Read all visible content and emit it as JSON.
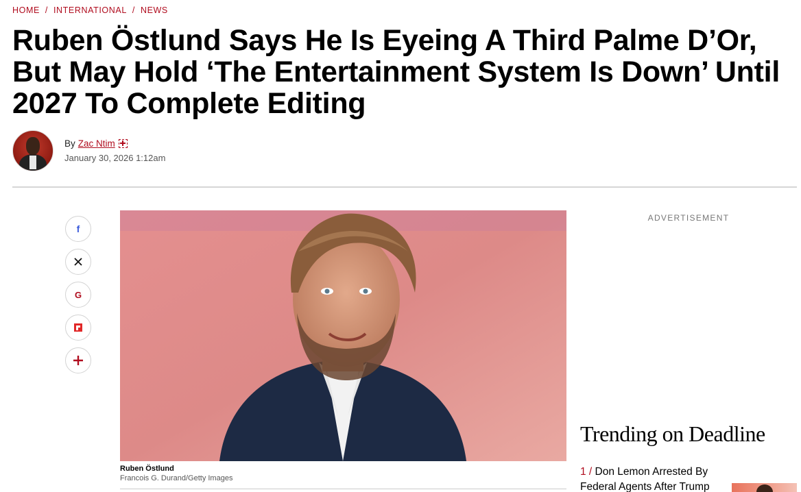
{
  "breadcrumb": {
    "items": [
      {
        "label": "HOME"
      },
      {
        "label": "INTERNATIONAL"
      },
      {
        "label": "NEWS"
      }
    ],
    "separator": "/"
  },
  "article": {
    "headline": "Ruben Östlund Says He Is Eyeing A Third Palme D’Or, But May Hold ‘The Entertainment System Is Down’ Until 2027 To Complete Editing",
    "byline": {
      "prefix": "By",
      "author": "Zac Ntim",
      "date": "January 30, 2026 1:12am"
    },
    "image": {
      "caption_name": "Ruben Östlund",
      "caption_credit": "Francois G. Durand/Getty Images"
    }
  },
  "share": {
    "buttons": [
      {
        "icon": "facebook-icon"
      },
      {
        "icon": "x-icon"
      },
      {
        "icon": "google-icon"
      },
      {
        "icon": "flipboard-icon"
      },
      {
        "icon": "plus-icon"
      }
    ]
  },
  "sidebar": {
    "ad_label": "ADVERTISEMENT",
    "trending": {
      "title": "Trending on Deadline",
      "items": [
        {
          "number": "1",
          "separator": " / ",
          "title": "Don Lemon Arrested By Federal Agents After Trump"
        }
      ]
    }
  },
  "colors": {
    "accent": "#b00c1e",
    "divider": "#d6d6d6"
  }
}
